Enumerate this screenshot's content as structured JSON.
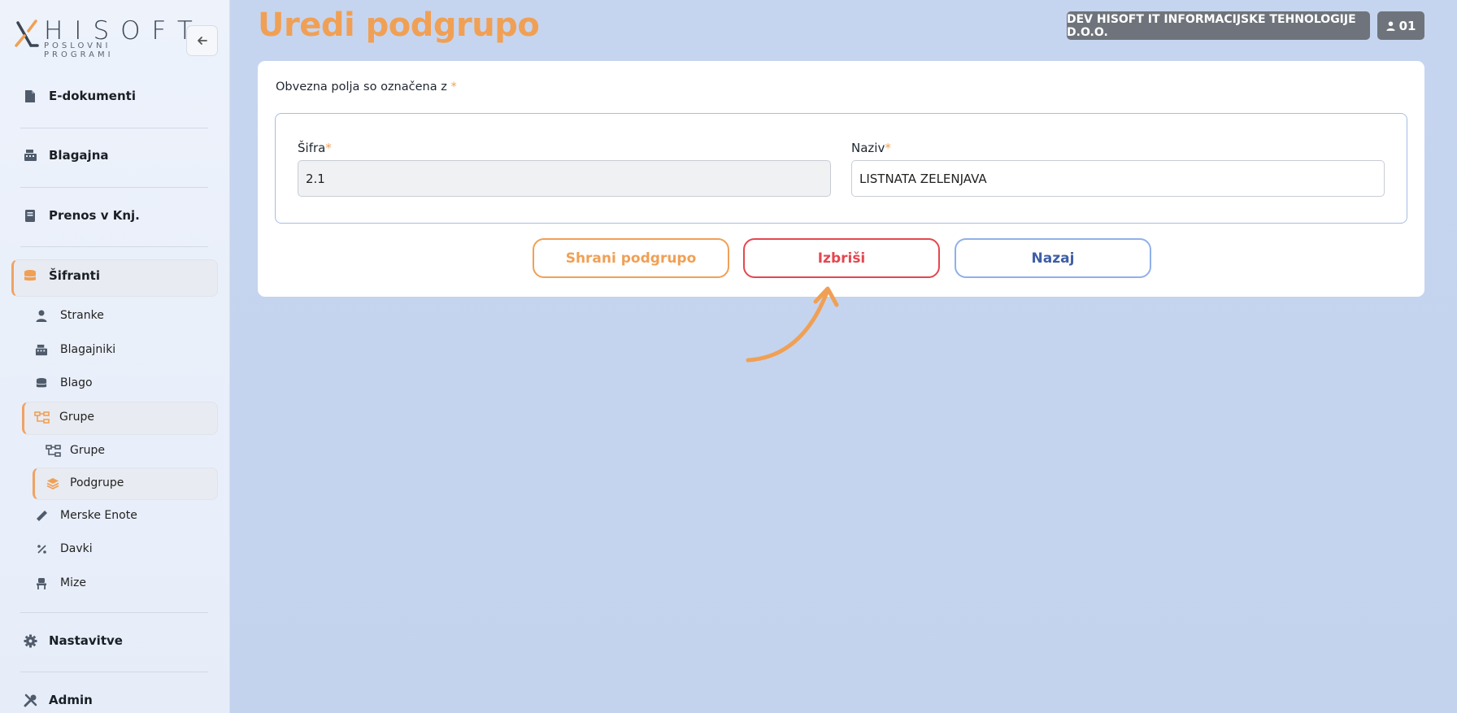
{
  "brand": {
    "name": "HISOFT",
    "tagline": "POSLOVNI PROGRAMI"
  },
  "sidebar": {
    "main_items": [
      {
        "label": "E-dokumenti",
        "icon": "file-icon"
      },
      {
        "label": "Blagajna",
        "icon": "cash-register-icon"
      },
      {
        "label": "Prenos v Knj.",
        "icon": "book-icon"
      },
      {
        "label": "Šifranti",
        "icon": "database-icon"
      }
    ],
    "sub_items": [
      {
        "label": "Stranke",
        "icon": "user-icon"
      },
      {
        "label": "Blagajniki",
        "icon": "cash-register-icon"
      },
      {
        "label": "Blago",
        "icon": "database-icon"
      },
      {
        "label": "Grupe",
        "icon": "sitemap-icon"
      }
    ],
    "grupe_children": [
      {
        "label": "Grupe",
        "icon": "sitemap-icon"
      },
      {
        "label": "Podgrupe",
        "icon": "layers-icon"
      }
    ],
    "sub_items_2": [
      {
        "label": "Merske Enote",
        "icon": "ruler-icon"
      },
      {
        "label": "Davki",
        "icon": "percent-icon"
      },
      {
        "label": "Mize",
        "icon": "chair-icon"
      }
    ],
    "bottom_items": [
      {
        "label": "Nastavitve",
        "icon": "gear-icon"
      },
      {
        "label": "Admin",
        "icon": "tools-icon"
      }
    ]
  },
  "header": {
    "title": "Uredi podgrupo",
    "company": "DEV HISOFT IT INFORMACIJSKE TEHNOLOGIJE D.O.O.",
    "user": "01"
  },
  "form": {
    "required_note": "Obvezna polja so označena z",
    "required_star": "*",
    "sifra_label": "Šifra",
    "sifra_value": "2.1",
    "naziv_label": "Naziv",
    "naziv_value": "LISTNATA ZELENJAVA"
  },
  "buttons": {
    "save": "Shrani podgrupo",
    "delete": "Izbriši",
    "back": "Nazaj"
  },
  "colors": {
    "accent": "#f0a055",
    "danger": "#e4474f",
    "primary": "#3e5ea6",
    "background": "#c6d5ef"
  }
}
